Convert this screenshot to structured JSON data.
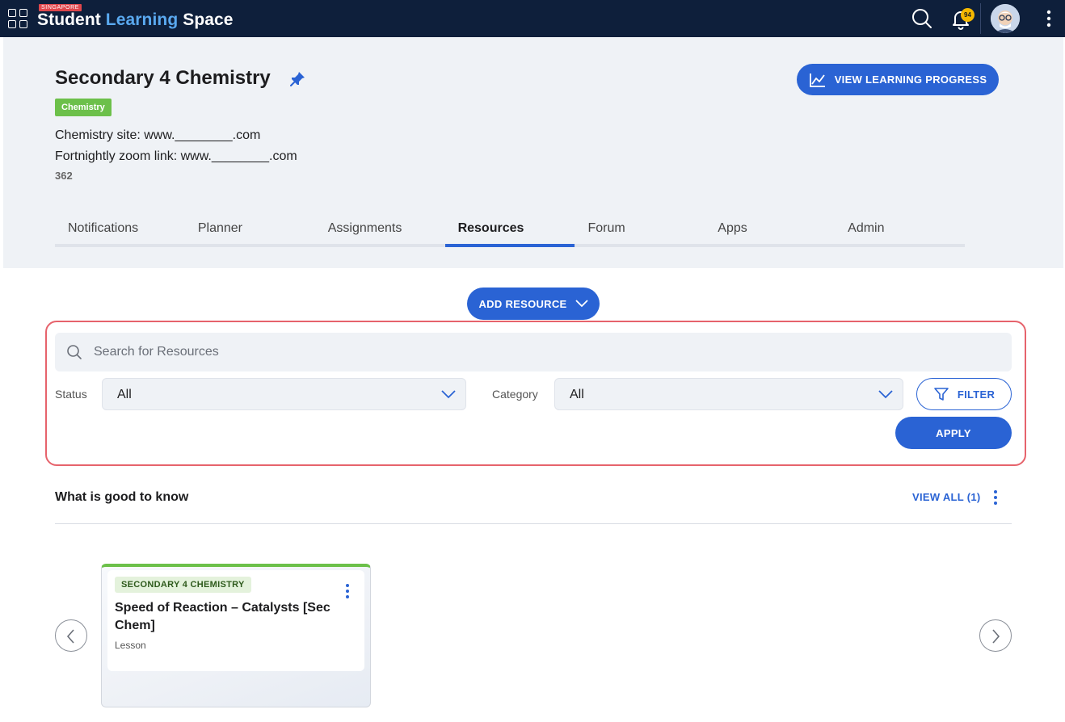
{
  "topbar": {
    "brand_tag": "SINGAPORE",
    "brand_part1": "Student ",
    "brand_part2": "Learning",
    "brand_part3": " Space",
    "notification_count": "94"
  },
  "course": {
    "title": "Secondary 4 Chemistry",
    "subject_badge": "Chemistry",
    "description_line1": "Chemistry site: www.________.com",
    "description_line2": "Fortnightly zoom link: www.________.com",
    "count": "362",
    "view_progress_label": "VIEW LEARNING PROGRESS"
  },
  "tabs": [
    {
      "label": "Notifications"
    },
    {
      "label": "Planner"
    },
    {
      "label": "Assignments"
    },
    {
      "label": "Resources"
    },
    {
      "label": "Forum"
    },
    {
      "label": "Apps"
    },
    {
      "label": "Admin"
    }
  ],
  "active_tab": "Resources",
  "resources": {
    "add_label": "ADD RESOURCE",
    "search_placeholder": "Search for Resources",
    "search_value": "",
    "status_label": "Status",
    "status_value": "All",
    "category_label": "Category",
    "category_value": "All",
    "filter_label": "FILTER",
    "apply_label": "APPLY"
  },
  "section": {
    "title": "What is good to know",
    "view_all_label": "VIEW ALL (1)"
  },
  "cards": [
    {
      "tag": "SECONDARY 4 CHEMISTRY",
      "title": "Speed of Reaction – Catalysts [Sec Chem]",
      "type": "Lesson"
    }
  ],
  "colors": {
    "topbar_bg": "#0e1f3b",
    "primary": "#2a63d4",
    "subject_green": "#6cc04a",
    "highlight_red": "#e6636c",
    "badge_yellow": "#f5b800"
  },
  "icons": [
    "apps-grid-icon",
    "search-icon",
    "bell-icon",
    "avatar",
    "more-vertical-icon",
    "pin-icon",
    "chart-line-icon",
    "chevron-down-icon",
    "filter-icon",
    "chevron-left-icon",
    "chevron-right-icon"
  ]
}
